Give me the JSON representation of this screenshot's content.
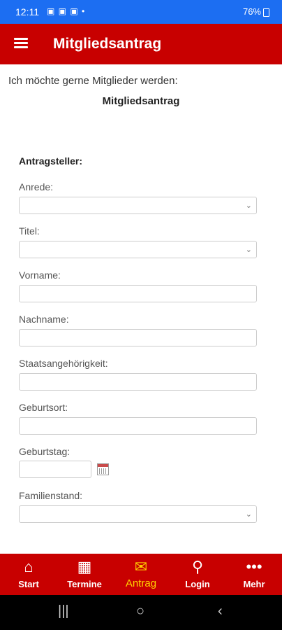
{
  "status": {
    "time": "12:11",
    "battery": "76%"
  },
  "appbar": {
    "title": "Mitgliedsantrag"
  },
  "intro": "Ich möchte gerne Mitglieder werden:",
  "form_title": "Mitgliedsantrag",
  "section": "Antragsteller:",
  "fields": {
    "anrede": "Anrede:",
    "titel": "Titel:",
    "vorname": "Vorname:",
    "nachname": "Nachname:",
    "staat": "Staatsangehörigkeit:",
    "geburtsort": "Geburtsort:",
    "geburtstag": "Geburtstag:",
    "familienstand": "Familienstand:"
  },
  "nav": {
    "start": "Start",
    "termine": "Termine",
    "antrag": "Antrag",
    "login": "Login",
    "mehr": "Mehr"
  },
  "colors": {
    "appbar": "#c80000",
    "active_nav": "#ffd200",
    "statusbar": "#1c6ef2"
  }
}
